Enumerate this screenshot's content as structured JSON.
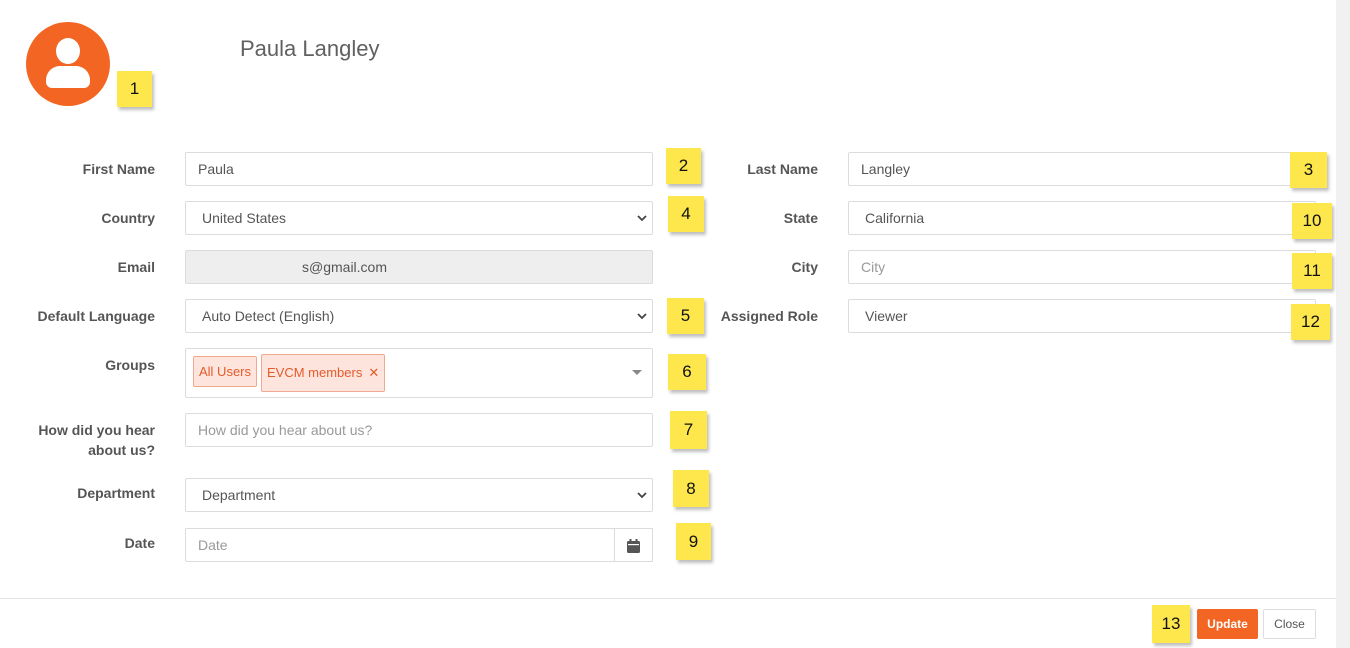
{
  "profile": {
    "name": "Paula Langley"
  },
  "form": {
    "first_name": {
      "label": "First Name",
      "value": "Paula"
    },
    "last_name": {
      "label": "Last Name",
      "value": "Langley"
    },
    "country": {
      "label": "Country",
      "value": "United States"
    },
    "state": {
      "label": "State",
      "value": "California"
    },
    "email": {
      "label": "Email",
      "value": "ѕ@gmail.com"
    },
    "city": {
      "label": "City",
      "placeholder": "City"
    },
    "default_language": {
      "label": "Default Language",
      "value": "Auto Detect (English)"
    },
    "assigned_role": {
      "label": "Assigned Role",
      "value": "Viewer"
    },
    "groups": {
      "label": "Groups",
      "tags": [
        "All Users",
        "EVCM members"
      ],
      "remove_glyph": "✕"
    },
    "hear_about": {
      "label_line1": "How did you hear",
      "label_line2": "about us?",
      "placeholder": "How did you hear about us?"
    },
    "department": {
      "label": "Department",
      "value": "Department"
    },
    "date": {
      "label": "Date",
      "placeholder": "Date"
    }
  },
  "badges": [
    "1",
    "2",
    "3",
    "4",
    "5",
    "6",
    "7",
    "8",
    "9",
    "10",
    "11",
    "12",
    "13"
  ],
  "footer": {
    "update_label": "Update",
    "close_label": "Close"
  },
  "colors": {
    "accent": "#f26522",
    "badge": "#fde74c",
    "tag_bg": "#fde4dc",
    "tag_text": "#e55a2b",
    "disabled_bg": "#eeeeee"
  },
  "icons": {
    "avatar": "user-icon",
    "date": "calendar-icon",
    "select": "chevron-down-icon",
    "groups": "caret-down-icon",
    "tag_remove": "close-icon"
  }
}
